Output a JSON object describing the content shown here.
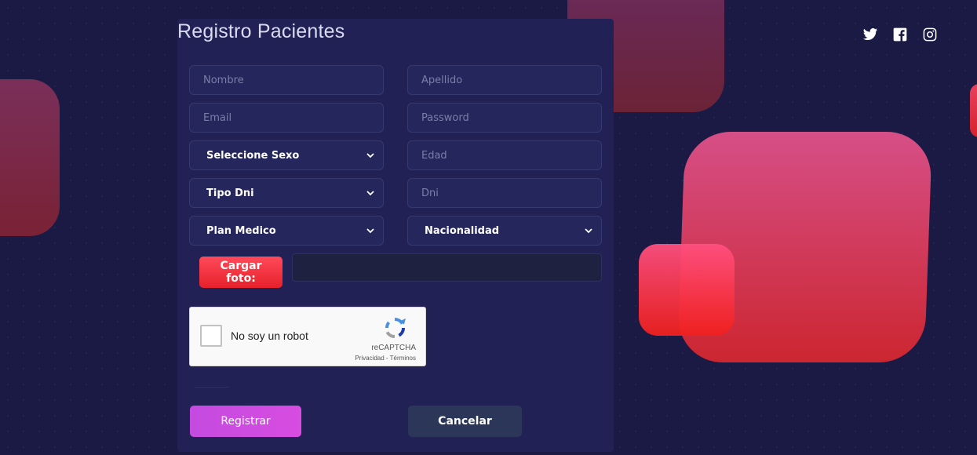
{
  "page": {
    "title": "Registro Pacientes"
  },
  "social": [
    "twitter-icon",
    "facebook-icon",
    "instagram-icon"
  ],
  "form": {
    "nombre_placeholder": "Nombre",
    "apellido_placeholder": "Apellido",
    "email_placeholder": "Email",
    "password_placeholder": "Password",
    "sexo_select": "Seleccione Sexo",
    "edad_placeholder": "Edad",
    "tipo_dni_select": "Tipo Dni",
    "dni_placeholder": "Dni",
    "plan_medico_select": "Plan Medico",
    "nacionalidad_select": "Nacionalidad",
    "upload_label": "Cargar foto:"
  },
  "recaptcha": {
    "label": "No soy un robot",
    "brand": "reCAPTCHA",
    "links": "Privacidad - Términos"
  },
  "buttons": {
    "register": "Registrar",
    "cancel": "Cancelar"
  },
  "colors": {
    "background": "#1a1a44",
    "panel": "#222155",
    "register_button": "#c44be0",
    "cancel_button": "#2b3659",
    "upload_button": "#e6212a"
  }
}
